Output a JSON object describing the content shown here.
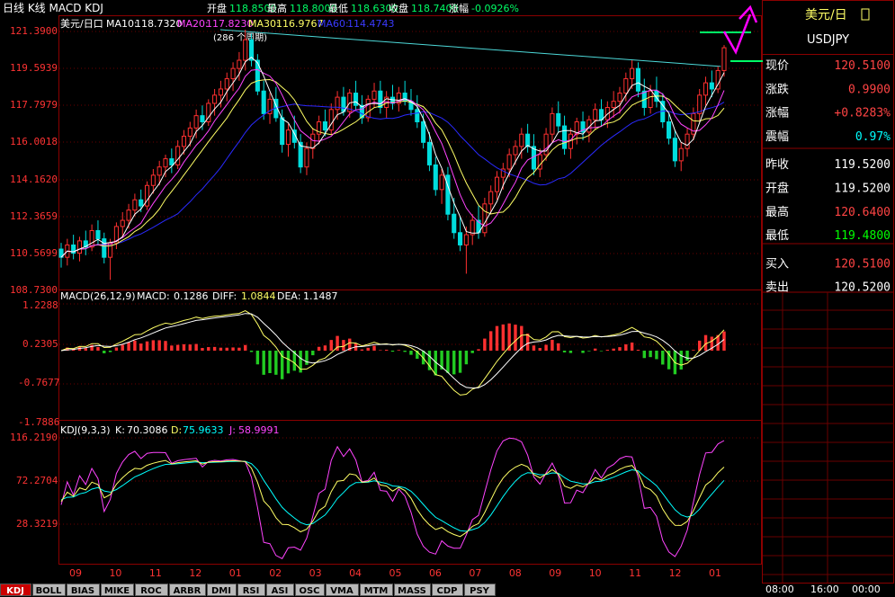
{
  "header": {
    "title": "日线 K线 MACD KDJ",
    "quote_items": [
      {
        "label": "开盘",
        "value": "118.8500"
      },
      {
        "label": "最高",
        "value": "118.8000"
      },
      {
        "label": "最低",
        "value": "118.6300"
      },
      {
        "label": "收盘",
        "value": "118.7400"
      },
      {
        "label": "涨幅",
        "value": "-0.0926%"
      }
    ]
  },
  "panels": {
    "main": {
      "symbol_label": "美元/日口",
      "ma": [
        {
          "label": "MA10:",
          "value": "118.7320",
          "color": "#ffffff"
        },
        {
          "label": "MA20:",
          "value": "117.8230",
          "color": "#ff44ff"
        },
        {
          "label": "MA30:",
          "value": "116.9767",
          "color": "#ffff66"
        },
        {
          "label": "MA60:",
          "value": "114.4743",
          "color": "#2a2aff"
        }
      ],
      "y_ticks": [
        "121.3900",
        "119.5939",
        "117.7979",
        "116.0018",
        "114.1620",
        "112.3659",
        "110.5699",
        "108.7300"
      ],
      "annotation": "(286 个周期)"
    },
    "macd": {
      "label": "MACD(26,12,9)",
      "items": [
        {
          "label": "MACD:",
          "value": "0.1286",
          "color": "#ffffff"
        },
        {
          "label": "DIFF:",
          "value": "1.0844",
          "color": "#ffffff"
        },
        {
          "label": "DEA:",
          "value": "1.1487",
          "color": "#ffff66"
        }
      ],
      "y_ticks": [
        "1.2288",
        "0.2305",
        "-0.7677",
        "-1.7886"
      ]
    },
    "kdj": {
      "label": "KDJ(9,3,3)",
      "items": [
        {
          "label": "K:",
          "value": "70.3086",
          "color": "#ffffff"
        },
        {
          "label": "D:",
          "value": "75.9633",
          "color": "#ffff66"
        },
        {
          "label": "J:",
          "value": "58.9991",
          "color": "#ff44ff"
        }
      ],
      "y_ticks": [
        "116.2190",
        "72.2704",
        "28.3219"
      ]
    }
  },
  "x_axis_labels": [
    "09",
    "10",
    "11",
    "12",
    "01",
    "02",
    "03",
    "04",
    "05",
    "06",
    "07",
    "08",
    "09",
    "10",
    "11",
    "12",
    "01"
  ],
  "bottom_tabs": [
    "KDJ",
    "BOLL",
    "BIAS",
    "MIKE",
    "ROC",
    "ARBR",
    "DMI",
    "RSI",
    "ASI",
    "OSC",
    "VMA",
    "MTM",
    "MASS",
    "CDP",
    "PSY"
  ],
  "active_tab": "KDJ",
  "right_panel": {
    "title": "美元/日",
    "code": "USDJPY",
    "rows": [
      {
        "label": "现价",
        "value": "120.5100",
        "color": "#ff4444"
      },
      {
        "label": "涨跌",
        "value": "0.9900",
        "color": "#ff4444"
      },
      {
        "label": "涨幅",
        "value": "+0.8283%",
        "color": "#ff4444"
      },
      {
        "label": "震幅",
        "value": "0.97%",
        "color": "#00ffff"
      },
      {
        "label": "昨收",
        "value": "119.5200",
        "color": "#ffffff"
      },
      {
        "label": "开盘",
        "value": "119.5200",
        "color": "#ffffff"
      },
      {
        "label": "最高",
        "value": "120.6400",
        "color": "#ff4444"
      },
      {
        "label": "最低",
        "value": "119.4800",
        "color": "#00ff00"
      },
      {
        "label": "买入",
        "value": "120.5100",
        "color": "#ff4444"
      },
      {
        "label": "卖出",
        "value": "120.5200",
        "color": "#ffffff"
      }
    ]
  },
  "time_labels": [
    "08:00",
    "16:00",
    "00:00"
  ],
  "colors": {
    "up": "#ff3030",
    "down": "#00dddd",
    "grid": "#800000",
    "ma10": "#ffffff",
    "ma20": "#ff44ff",
    "ma30": "#ffff66",
    "ma60": "#2a2aff",
    "macd_pos": "#ff3030",
    "macd_neg": "#22cc22",
    "accent_magenta": "#ff00ff",
    "accent_green": "#00ff66"
  },
  "chart_data": {
    "type": "candlestick",
    "title": "",
    "ylim": [
      108.73,
      121.39
    ],
    "x_labels": [
      "09",
      "10",
      "11",
      "12",
      "01",
      "02",
      "03",
      "04",
      "05",
      "06",
      "07",
      "08",
      "09",
      "10",
      "11",
      "12",
      "01"
    ],
    "trend_line": {
      "from": [
        0.24,
        121.39
      ],
      "to": [
        0.995,
        119.6
      ]
    },
    "ohlc": [
      {
        "o": 110.7,
        "h": 111.0,
        "l": 109.8,
        "c": 110.3
      },
      {
        "o": 110.3,
        "h": 111.2,
        "l": 109.9,
        "c": 110.9
      },
      {
        "o": 110.9,
        "h": 111.4,
        "l": 110.2,
        "c": 110.5
      },
      {
        "o": 110.5,
        "h": 111.3,
        "l": 110.1,
        "c": 111.1
      },
      {
        "o": 111.1,
        "h": 111.6,
        "l": 110.4,
        "c": 110.8
      },
      {
        "o": 110.8,
        "h": 111.9,
        "l": 110.6,
        "c": 111.6
      },
      {
        "o": 111.6,
        "h": 112.1,
        "l": 110.9,
        "c": 111.2
      },
      {
        "o": 111.2,
        "h": 111.5,
        "l": 110.0,
        "c": 110.3
      },
      {
        "o": 110.3,
        "h": 111.2,
        "l": 109.2,
        "c": 111.0
      },
      {
        "o": 111.0,
        "h": 112.0,
        "l": 110.7,
        "c": 111.8
      },
      {
        "o": 111.8,
        "h": 112.5,
        "l": 111.3,
        "c": 112.1
      },
      {
        "o": 112.1,
        "h": 112.9,
        "l": 111.7,
        "c": 112.6
      },
      {
        "o": 112.6,
        "h": 113.4,
        "l": 112.3,
        "c": 113.1
      },
      {
        "o": 113.1,
        "h": 113.6,
        "l": 112.5,
        "c": 112.8
      },
      {
        "o": 112.8,
        "h": 114.0,
        "l": 112.6,
        "c": 113.8
      },
      {
        "o": 113.8,
        "h": 114.6,
        "l": 113.4,
        "c": 114.3
      },
      {
        "o": 114.3,
        "h": 115.0,
        "l": 113.8,
        "c": 114.7
      },
      {
        "o": 114.7,
        "h": 115.3,
        "l": 114.2,
        "c": 115.1
      },
      {
        "o": 115.1,
        "h": 115.6,
        "l": 114.4,
        "c": 114.8
      },
      {
        "o": 114.8,
        "h": 116.0,
        "l": 114.6,
        "c": 115.7
      },
      {
        "o": 115.7,
        "h": 116.5,
        "l": 115.3,
        "c": 116.2
      },
      {
        "o": 116.2,
        "h": 116.9,
        "l": 115.7,
        "c": 116.6
      },
      {
        "o": 116.6,
        "h": 117.5,
        "l": 116.1,
        "c": 117.2
      },
      {
        "o": 117.2,
        "h": 117.7,
        "l": 116.5,
        "c": 116.9
      },
      {
        "o": 116.9,
        "h": 118.0,
        "l": 116.7,
        "c": 117.8
      },
      {
        "o": 117.8,
        "h": 118.5,
        "l": 117.2,
        "c": 118.2
      },
      {
        "o": 118.2,
        "h": 118.9,
        "l": 117.6,
        "c": 118.5
      },
      {
        "o": 118.5,
        "h": 119.3,
        "l": 117.9,
        "c": 119.0
      },
      {
        "o": 119.0,
        "h": 119.8,
        "l": 118.4,
        "c": 119.5
      },
      {
        "o": 119.5,
        "h": 120.3,
        "l": 118.9,
        "c": 119.9
      },
      {
        "o": 119.9,
        "h": 121.39,
        "l": 119.4,
        "c": 120.9
      },
      {
        "o": 120.9,
        "h": 121.2,
        "l": 119.6,
        "c": 119.9
      },
      {
        "o": 119.9,
        "h": 120.2,
        "l": 118.2,
        "c": 118.4
      },
      {
        "o": 118.4,
        "h": 118.9,
        "l": 117.0,
        "c": 117.3
      },
      {
        "o": 117.3,
        "h": 118.3,
        "l": 116.8,
        "c": 118.0
      },
      {
        "o": 118.0,
        "h": 118.6,
        "l": 116.9,
        "c": 117.1
      },
      {
        "o": 117.1,
        "h": 117.5,
        "l": 115.4,
        "c": 115.8
      },
      {
        "o": 115.8,
        "h": 116.8,
        "l": 115.2,
        "c": 116.5
      },
      {
        "o": 116.5,
        "h": 117.2,
        "l": 115.6,
        "c": 115.9
      },
      {
        "o": 115.9,
        "h": 116.3,
        "l": 114.4,
        "c": 114.7
      },
      {
        "o": 114.7,
        "h": 115.9,
        "l": 114.3,
        "c": 115.6
      },
      {
        "o": 115.6,
        "h": 116.6,
        "l": 115.1,
        "c": 116.3
      },
      {
        "o": 116.3,
        "h": 117.2,
        "l": 115.8,
        "c": 116.9
      },
      {
        "o": 116.9,
        "h": 117.5,
        "l": 116.2,
        "c": 116.5
      },
      {
        "o": 116.5,
        "h": 117.8,
        "l": 116.3,
        "c": 117.5
      },
      {
        "o": 117.5,
        "h": 118.4,
        "l": 117.0,
        "c": 118.1
      },
      {
        "o": 118.1,
        "h": 118.6,
        "l": 117.2,
        "c": 117.4
      },
      {
        "o": 117.4,
        "h": 118.5,
        "l": 117.1,
        "c": 118.3
      },
      {
        "o": 118.3,
        "h": 118.9,
        "l": 117.5,
        "c": 117.7
      },
      {
        "o": 117.7,
        "h": 118.2,
        "l": 116.8,
        "c": 117.1
      },
      {
        "o": 117.1,
        "h": 118.2,
        "l": 116.9,
        "c": 118.0
      },
      {
        "o": 118.0,
        "h": 118.8,
        "l": 117.6,
        "c": 118.4
      },
      {
        "o": 118.4,
        "h": 118.9,
        "l": 117.3,
        "c": 117.6
      },
      {
        "o": 117.6,
        "h": 118.4,
        "l": 117.1,
        "c": 118.1
      },
      {
        "o": 118.1,
        "h": 118.7,
        "l": 117.5,
        "c": 117.8
      },
      {
        "o": 117.8,
        "h": 118.6,
        "l": 117.4,
        "c": 118.3
      },
      {
        "o": 118.3,
        "h": 118.9,
        "l": 117.7,
        "c": 117.9
      },
      {
        "o": 117.9,
        "h": 118.5,
        "l": 117.2,
        "c": 117.5
      },
      {
        "o": 117.5,
        "h": 118.2,
        "l": 116.6,
        "c": 116.9
      },
      {
        "o": 116.9,
        "h": 117.3,
        "l": 115.6,
        "c": 115.9
      },
      {
        "o": 115.9,
        "h": 116.4,
        "l": 114.5,
        "c": 114.8
      },
      {
        "o": 114.8,
        "h": 115.2,
        "l": 113.3,
        "c": 113.6
      },
      {
        "o": 113.6,
        "h": 114.6,
        "l": 112.9,
        "c": 114.3
      },
      {
        "o": 114.3,
        "h": 114.7,
        "l": 112.1,
        "c": 112.4
      },
      {
        "o": 112.4,
        "h": 113.2,
        "l": 111.2,
        "c": 111.5
      },
      {
        "o": 111.5,
        "h": 112.3,
        "l": 110.6,
        "c": 110.9
      },
      {
        "o": 110.9,
        "h": 111.8,
        "l": 109.5,
        "c": 111.4
      },
      {
        "o": 111.4,
        "h": 112.4,
        "l": 110.9,
        "c": 112.1
      },
      {
        "o": 112.1,
        "h": 112.8,
        "l": 111.2,
        "c": 111.5
      },
      {
        "o": 111.5,
        "h": 113.2,
        "l": 111.3,
        "c": 112.9
      },
      {
        "o": 112.9,
        "h": 113.8,
        "l": 112.4,
        "c": 113.5
      },
      {
        "o": 113.5,
        "h": 114.5,
        "l": 113.1,
        "c": 114.2
      },
      {
        "o": 114.2,
        "h": 114.9,
        "l": 113.6,
        "c": 114.6
      },
      {
        "o": 114.6,
        "h": 115.6,
        "l": 114.2,
        "c": 115.3
      },
      {
        "o": 115.3,
        "h": 116.0,
        "l": 114.8,
        "c": 115.7
      },
      {
        "o": 115.7,
        "h": 116.6,
        "l": 115.1,
        "c": 116.3
      },
      {
        "o": 116.3,
        "h": 116.8,
        "l": 115.4,
        "c": 115.7
      },
      {
        "o": 115.7,
        "h": 116.3,
        "l": 114.3,
        "c": 114.6
      },
      {
        "o": 114.6,
        "h": 115.6,
        "l": 114.2,
        "c": 115.3
      },
      {
        "o": 115.3,
        "h": 116.6,
        "l": 115.0,
        "c": 116.3
      },
      {
        "o": 116.3,
        "h": 117.6,
        "l": 115.9,
        "c": 117.3
      },
      {
        "o": 117.3,
        "h": 117.9,
        "l": 116.4,
        "c": 116.7
      },
      {
        "o": 116.7,
        "h": 117.2,
        "l": 115.3,
        "c": 115.6
      },
      {
        "o": 115.6,
        "h": 116.6,
        "l": 115.1,
        "c": 116.3
      },
      {
        "o": 116.3,
        "h": 117.1,
        "l": 115.8,
        "c": 116.9
      },
      {
        "o": 116.9,
        "h": 117.4,
        "l": 116.0,
        "c": 116.4
      },
      {
        "o": 116.4,
        "h": 117.2,
        "l": 115.9,
        "c": 117.0
      },
      {
        "o": 117.0,
        "h": 117.8,
        "l": 116.5,
        "c": 117.5
      },
      {
        "o": 117.5,
        "h": 118.0,
        "l": 116.7,
        "c": 117.0
      },
      {
        "o": 117.0,
        "h": 117.9,
        "l": 116.6,
        "c": 117.6
      },
      {
        "o": 117.6,
        "h": 118.4,
        "l": 117.1,
        "c": 117.9
      },
      {
        "o": 117.9,
        "h": 118.6,
        "l": 117.3,
        "c": 118.3
      },
      {
        "o": 118.3,
        "h": 119.3,
        "l": 117.9,
        "c": 119.0
      },
      {
        "o": 119.0,
        "h": 119.9,
        "l": 118.5,
        "c": 119.5
      },
      {
        "o": 119.5,
        "h": 119.8,
        "l": 118.1,
        "c": 118.4
      },
      {
        "o": 118.4,
        "h": 119.0,
        "l": 117.2,
        "c": 117.6
      },
      {
        "o": 117.6,
        "h": 118.7,
        "l": 117.3,
        "c": 118.4
      },
      {
        "o": 118.4,
        "h": 119.1,
        "l": 117.6,
        "c": 117.9
      },
      {
        "o": 117.9,
        "h": 118.3,
        "l": 116.6,
        "c": 116.9
      },
      {
        "o": 116.9,
        "h": 117.3,
        "l": 115.8,
        "c": 116.1
      },
      {
        "o": 116.1,
        "h": 116.5,
        "l": 114.7,
        "c": 115.0
      },
      {
        "o": 115.0,
        "h": 115.9,
        "l": 114.5,
        "c": 115.6
      },
      {
        "o": 115.6,
        "h": 116.6,
        "l": 115.2,
        "c": 116.3
      },
      {
        "o": 116.3,
        "h": 117.6,
        "l": 116.0,
        "c": 117.3
      },
      {
        "o": 117.3,
        "h": 118.5,
        "l": 116.9,
        "c": 118.2
      },
      {
        "o": 118.2,
        "h": 119.1,
        "l": 117.7,
        "c": 118.8
      },
      {
        "o": 118.8,
        "h": 119.4,
        "l": 118.1,
        "c": 118.5
      },
      {
        "o": 118.5,
        "h": 119.6,
        "l": 118.3,
        "c": 119.4
      },
      {
        "o": 119.4,
        "h": 120.64,
        "l": 119.1,
        "c": 120.51
      }
    ]
  }
}
